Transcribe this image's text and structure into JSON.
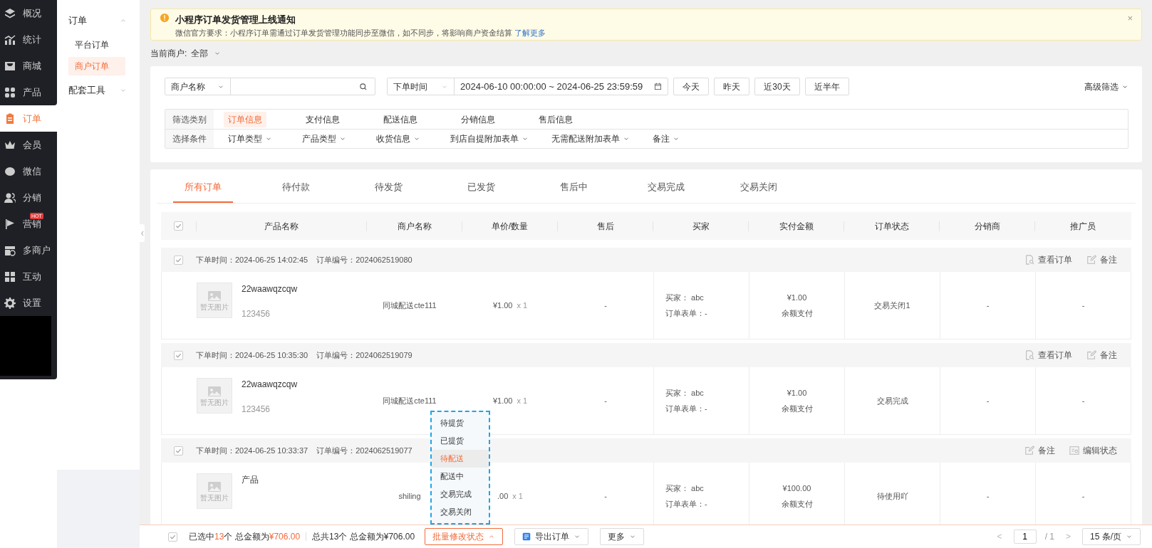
{
  "main_nav": {
    "items": [
      {
        "label": "概况",
        "selected": false
      },
      {
        "label": "统计",
        "selected": false
      },
      {
        "label": "商城",
        "selected": false
      },
      {
        "label": "产品",
        "selected": false
      },
      {
        "label": "订单",
        "selected": true
      },
      {
        "label": "会员",
        "selected": false
      },
      {
        "label": "微信",
        "selected": false
      },
      {
        "label": "分销",
        "selected": false
      },
      {
        "label": "营销",
        "selected": false,
        "badge": "HOT"
      },
      {
        "label": "多商户",
        "selected": false
      },
      {
        "label": "互动",
        "selected": false
      },
      {
        "label": "设置",
        "selected": false
      }
    ]
  },
  "sub_nav": {
    "groups": [
      {
        "label": "订单",
        "expanded": true,
        "children": [
          {
            "label": "平台订单",
            "selected": false
          },
          {
            "label": "商户订单",
            "selected": true
          }
        ]
      },
      {
        "label": "配套工具",
        "expanded": false
      }
    ]
  },
  "notice": {
    "title": "小程序订单发货管理上线通知",
    "text": "微信官方要求：小程序订单需通过订单发货管理功能同步至微信，如不同步，将影响商户资金结算",
    "link": "了解更多",
    "close": "×"
  },
  "merchant_filter": {
    "label": "当前商户:",
    "value": "全部"
  },
  "search": {
    "field_select": "商户名称",
    "time_select": "下单时间",
    "date_range": "2024-06-10 00:00:00 ~ 2024-06-25 23:59:59",
    "quick_ranges": [
      "今天",
      "昨天",
      "近30天",
      "近半年"
    ],
    "advanced": "高级筛选"
  },
  "filter_table": {
    "category_label": "筛选类别",
    "categories": [
      {
        "label": "订单信息",
        "selected": true
      },
      {
        "label": "支付信息",
        "selected": false
      },
      {
        "label": "配送信息",
        "selected": false
      },
      {
        "label": "分销信息",
        "selected": false
      },
      {
        "label": "售后信息",
        "selected": false
      }
    ],
    "condition_label": "选择条件",
    "conditions": [
      "订单类型",
      "产品类型",
      "收货信息",
      "到店自提附加表单",
      "无需配送附加表单",
      "备注"
    ]
  },
  "tabs": [
    {
      "label": "所有订单",
      "selected": true
    },
    {
      "label": "待付款",
      "selected": false
    },
    {
      "label": "待发货",
      "selected": false
    },
    {
      "label": "已发货",
      "selected": false
    },
    {
      "label": "售后中",
      "selected": false
    },
    {
      "label": "交易完成",
      "selected": false
    },
    {
      "label": "交易关闭",
      "selected": false
    }
  ],
  "table": {
    "header_checked": true,
    "columns": [
      "产品名称",
      "商户名称",
      "单价/数量",
      "售后",
      "买家",
      "实付金额",
      "订单状态",
      "分销商",
      "推广员"
    ],
    "orders": [
      {
        "checked": true,
        "time": "下单时间：2024-06-25 14:02:45",
        "order_no": "订单编号：2024062519080",
        "actions": [
          {
            "kind": "view",
            "label": "查看订单"
          },
          {
            "kind": "note",
            "label": "备注"
          }
        ],
        "thumb_text": "暂无图片",
        "product": "22waawqzcqw",
        "code": "123456",
        "merchant": "同城配送cte111",
        "price": "¥1.00",
        "qty": "x 1",
        "after_sale": "-",
        "buyer": "买家： abc",
        "form": "订单表单：-",
        "paid": "¥1.00",
        "pay_method": "余额支付",
        "status": "交易关闭1",
        "distributor": "-",
        "promoter": "-"
      },
      {
        "checked": true,
        "time": "下单时间：2024-06-25 10:35:30",
        "order_no": "订单编号：2024062519079",
        "actions": [
          {
            "kind": "view",
            "label": "查看订单"
          },
          {
            "kind": "note",
            "label": "备注"
          }
        ],
        "thumb_text": "暂无图片",
        "product": "22waawqzcqw",
        "code": "123456",
        "merchant": "同城配送cte111",
        "price": "¥1.00",
        "qty": "x 1",
        "after_sale": "-",
        "buyer": "买家： abc",
        "form": "订单表单：-",
        "paid": "¥1.00",
        "pay_method": "余额支付",
        "status": "交易完成",
        "distributor": "-",
        "promoter": "-"
      },
      {
        "checked": true,
        "time": "下单时间：2024-06-25 10:33:37",
        "order_no": "订单编号：2024062519077",
        "actions": [
          {
            "kind": "note",
            "label": "备注"
          },
          {
            "kind": "edit",
            "label": "编辑状态"
          }
        ],
        "thumb_text": "暂无图片",
        "product": "产品",
        "merchant": "shiling",
        "price": ".00",
        "qty": "x 1",
        "after_sale": "-",
        "buyer": "买家： abc",
        "form": "订单表单：-",
        "paid": "¥100.00",
        "pay_method": "余额支付",
        "status": "待使用吖",
        "distributor": "-",
        "promoter": "-"
      }
    ]
  },
  "status_menu": {
    "items": [
      {
        "label": "待提货",
        "selected": false
      },
      {
        "label": "已提货",
        "selected": false
      },
      {
        "label": "待配送",
        "selected": true
      },
      {
        "label": "配送中",
        "selected": false
      },
      {
        "label": "交易完成",
        "selected": false
      },
      {
        "label": "交易关闭",
        "selected": false
      }
    ]
  },
  "bottom_bar": {
    "checked": true,
    "selected_summary": [
      {
        "text": "已选中",
        "highlight": false
      },
      {
        "text": "13",
        "highlight": true
      },
      {
        "text": "个 总金额为",
        "highlight": false
      },
      {
        "text": "¥706.00",
        "highlight": true
      }
    ],
    "total_summary": "总共13个 总金额为¥706.00",
    "batch_button": "批量修改状态",
    "export_button": "导出订单",
    "more_button": "更多",
    "prev": "<",
    "page": "1",
    "page_total": "/ 1",
    "next": ">",
    "page_size": "15 条/页"
  }
}
